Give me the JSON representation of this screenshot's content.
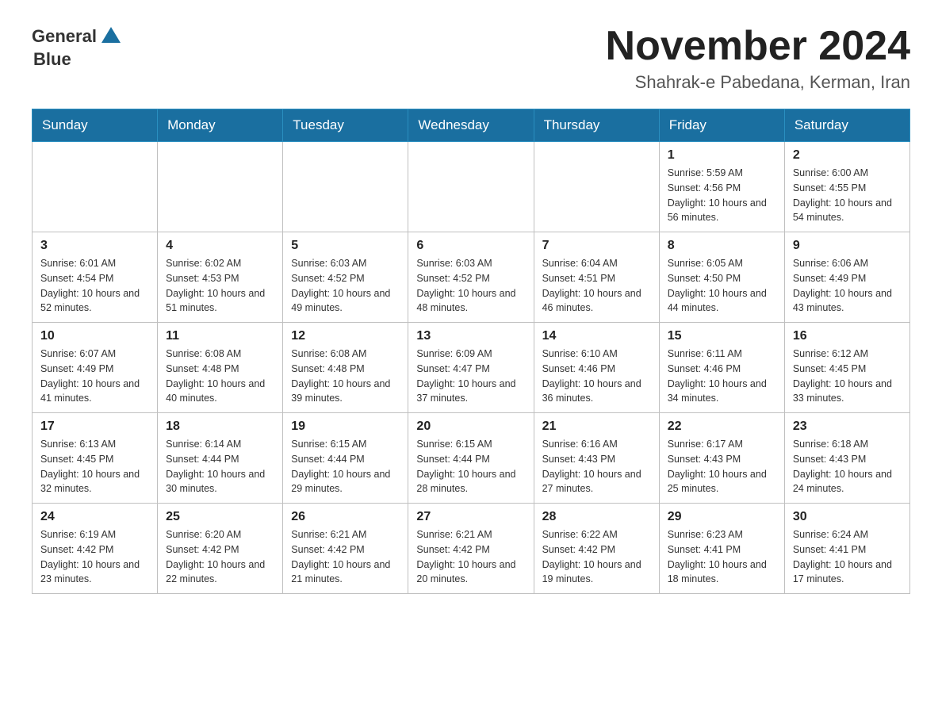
{
  "header": {
    "logo_text_general": "General",
    "logo_text_blue": "Blue",
    "month_title": "November 2024",
    "location": "Shahrak-e Pabedana, Kerman, Iran"
  },
  "calendar": {
    "days_of_week": [
      "Sunday",
      "Monday",
      "Tuesday",
      "Wednesday",
      "Thursday",
      "Friday",
      "Saturday"
    ],
    "weeks": [
      [
        {
          "day": "",
          "sunrise": "",
          "sunset": "",
          "daylight": ""
        },
        {
          "day": "",
          "sunrise": "",
          "sunset": "",
          "daylight": ""
        },
        {
          "day": "",
          "sunrise": "",
          "sunset": "",
          "daylight": ""
        },
        {
          "day": "",
          "sunrise": "",
          "sunset": "",
          "daylight": ""
        },
        {
          "day": "",
          "sunrise": "",
          "sunset": "",
          "daylight": ""
        },
        {
          "day": "1",
          "sunrise": "Sunrise: 5:59 AM",
          "sunset": "Sunset: 4:56 PM",
          "daylight": "Daylight: 10 hours and 56 minutes."
        },
        {
          "day": "2",
          "sunrise": "Sunrise: 6:00 AM",
          "sunset": "Sunset: 4:55 PM",
          "daylight": "Daylight: 10 hours and 54 minutes."
        }
      ],
      [
        {
          "day": "3",
          "sunrise": "Sunrise: 6:01 AM",
          "sunset": "Sunset: 4:54 PM",
          "daylight": "Daylight: 10 hours and 52 minutes."
        },
        {
          "day": "4",
          "sunrise": "Sunrise: 6:02 AM",
          "sunset": "Sunset: 4:53 PM",
          "daylight": "Daylight: 10 hours and 51 minutes."
        },
        {
          "day": "5",
          "sunrise": "Sunrise: 6:03 AM",
          "sunset": "Sunset: 4:52 PM",
          "daylight": "Daylight: 10 hours and 49 minutes."
        },
        {
          "day": "6",
          "sunrise": "Sunrise: 6:03 AM",
          "sunset": "Sunset: 4:52 PM",
          "daylight": "Daylight: 10 hours and 48 minutes."
        },
        {
          "day": "7",
          "sunrise": "Sunrise: 6:04 AM",
          "sunset": "Sunset: 4:51 PM",
          "daylight": "Daylight: 10 hours and 46 minutes."
        },
        {
          "day": "8",
          "sunrise": "Sunrise: 6:05 AM",
          "sunset": "Sunset: 4:50 PM",
          "daylight": "Daylight: 10 hours and 44 minutes."
        },
        {
          "day": "9",
          "sunrise": "Sunrise: 6:06 AM",
          "sunset": "Sunset: 4:49 PM",
          "daylight": "Daylight: 10 hours and 43 minutes."
        }
      ],
      [
        {
          "day": "10",
          "sunrise": "Sunrise: 6:07 AM",
          "sunset": "Sunset: 4:49 PM",
          "daylight": "Daylight: 10 hours and 41 minutes."
        },
        {
          "day": "11",
          "sunrise": "Sunrise: 6:08 AM",
          "sunset": "Sunset: 4:48 PM",
          "daylight": "Daylight: 10 hours and 40 minutes."
        },
        {
          "day": "12",
          "sunrise": "Sunrise: 6:08 AM",
          "sunset": "Sunset: 4:48 PM",
          "daylight": "Daylight: 10 hours and 39 minutes."
        },
        {
          "day": "13",
          "sunrise": "Sunrise: 6:09 AM",
          "sunset": "Sunset: 4:47 PM",
          "daylight": "Daylight: 10 hours and 37 minutes."
        },
        {
          "day": "14",
          "sunrise": "Sunrise: 6:10 AM",
          "sunset": "Sunset: 4:46 PM",
          "daylight": "Daylight: 10 hours and 36 minutes."
        },
        {
          "day": "15",
          "sunrise": "Sunrise: 6:11 AM",
          "sunset": "Sunset: 4:46 PM",
          "daylight": "Daylight: 10 hours and 34 minutes."
        },
        {
          "day": "16",
          "sunrise": "Sunrise: 6:12 AM",
          "sunset": "Sunset: 4:45 PM",
          "daylight": "Daylight: 10 hours and 33 minutes."
        }
      ],
      [
        {
          "day": "17",
          "sunrise": "Sunrise: 6:13 AM",
          "sunset": "Sunset: 4:45 PM",
          "daylight": "Daylight: 10 hours and 32 minutes."
        },
        {
          "day": "18",
          "sunrise": "Sunrise: 6:14 AM",
          "sunset": "Sunset: 4:44 PM",
          "daylight": "Daylight: 10 hours and 30 minutes."
        },
        {
          "day": "19",
          "sunrise": "Sunrise: 6:15 AM",
          "sunset": "Sunset: 4:44 PM",
          "daylight": "Daylight: 10 hours and 29 minutes."
        },
        {
          "day": "20",
          "sunrise": "Sunrise: 6:15 AM",
          "sunset": "Sunset: 4:44 PM",
          "daylight": "Daylight: 10 hours and 28 minutes."
        },
        {
          "day": "21",
          "sunrise": "Sunrise: 6:16 AM",
          "sunset": "Sunset: 4:43 PM",
          "daylight": "Daylight: 10 hours and 27 minutes."
        },
        {
          "day": "22",
          "sunrise": "Sunrise: 6:17 AM",
          "sunset": "Sunset: 4:43 PM",
          "daylight": "Daylight: 10 hours and 25 minutes."
        },
        {
          "day": "23",
          "sunrise": "Sunrise: 6:18 AM",
          "sunset": "Sunset: 4:43 PM",
          "daylight": "Daylight: 10 hours and 24 minutes."
        }
      ],
      [
        {
          "day": "24",
          "sunrise": "Sunrise: 6:19 AM",
          "sunset": "Sunset: 4:42 PM",
          "daylight": "Daylight: 10 hours and 23 minutes."
        },
        {
          "day": "25",
          "sunrise": "Sunrise: 6:20 AM",
          "sunset": "Sunset: 4:42 PM",
          "daylight": "Daylight: 10 hours and 22 minutes."
        },
        {
          "day": "26",
          "sunrise": "Sunrise: 6:21 AM",
          "sunset": "Sunset: 4:42 PM",
          "daylight": "Daylight: 10 hours and 21 minutes."
        },
        {
          "day": "27",
          "sunrise": "Sunrise: 6:21 AM",
          "sunset": "Sunset: 4:42 PM",
          "daylight": "Daylight: 10 hours and 20 minutes."
        },
        {
          "day": "28",
          "sunrise": "Sunrise: 6:22 AM",
          "sunset": "Sunset: 4:42 PM",
          "daylight": "Daylight: 10 hours and 19 minutes."
        },
        {
          "day": "29",
          "sunrise": "Sunrise: 6:23 AM",
          "sunset": "Sunset: 4:41 PM",
          "daylight": "Daylight: 10 hours and 18 minutes."
        },
        {
          "day": "30",
          "sunrise": "Sunrise: 6:24 AM",
          "sunset": "Sunset: 4:41 PM",
          "daylight": "Daylight: 10 hours and 17 minutes."
        }
      ]
    ]
  }
}
